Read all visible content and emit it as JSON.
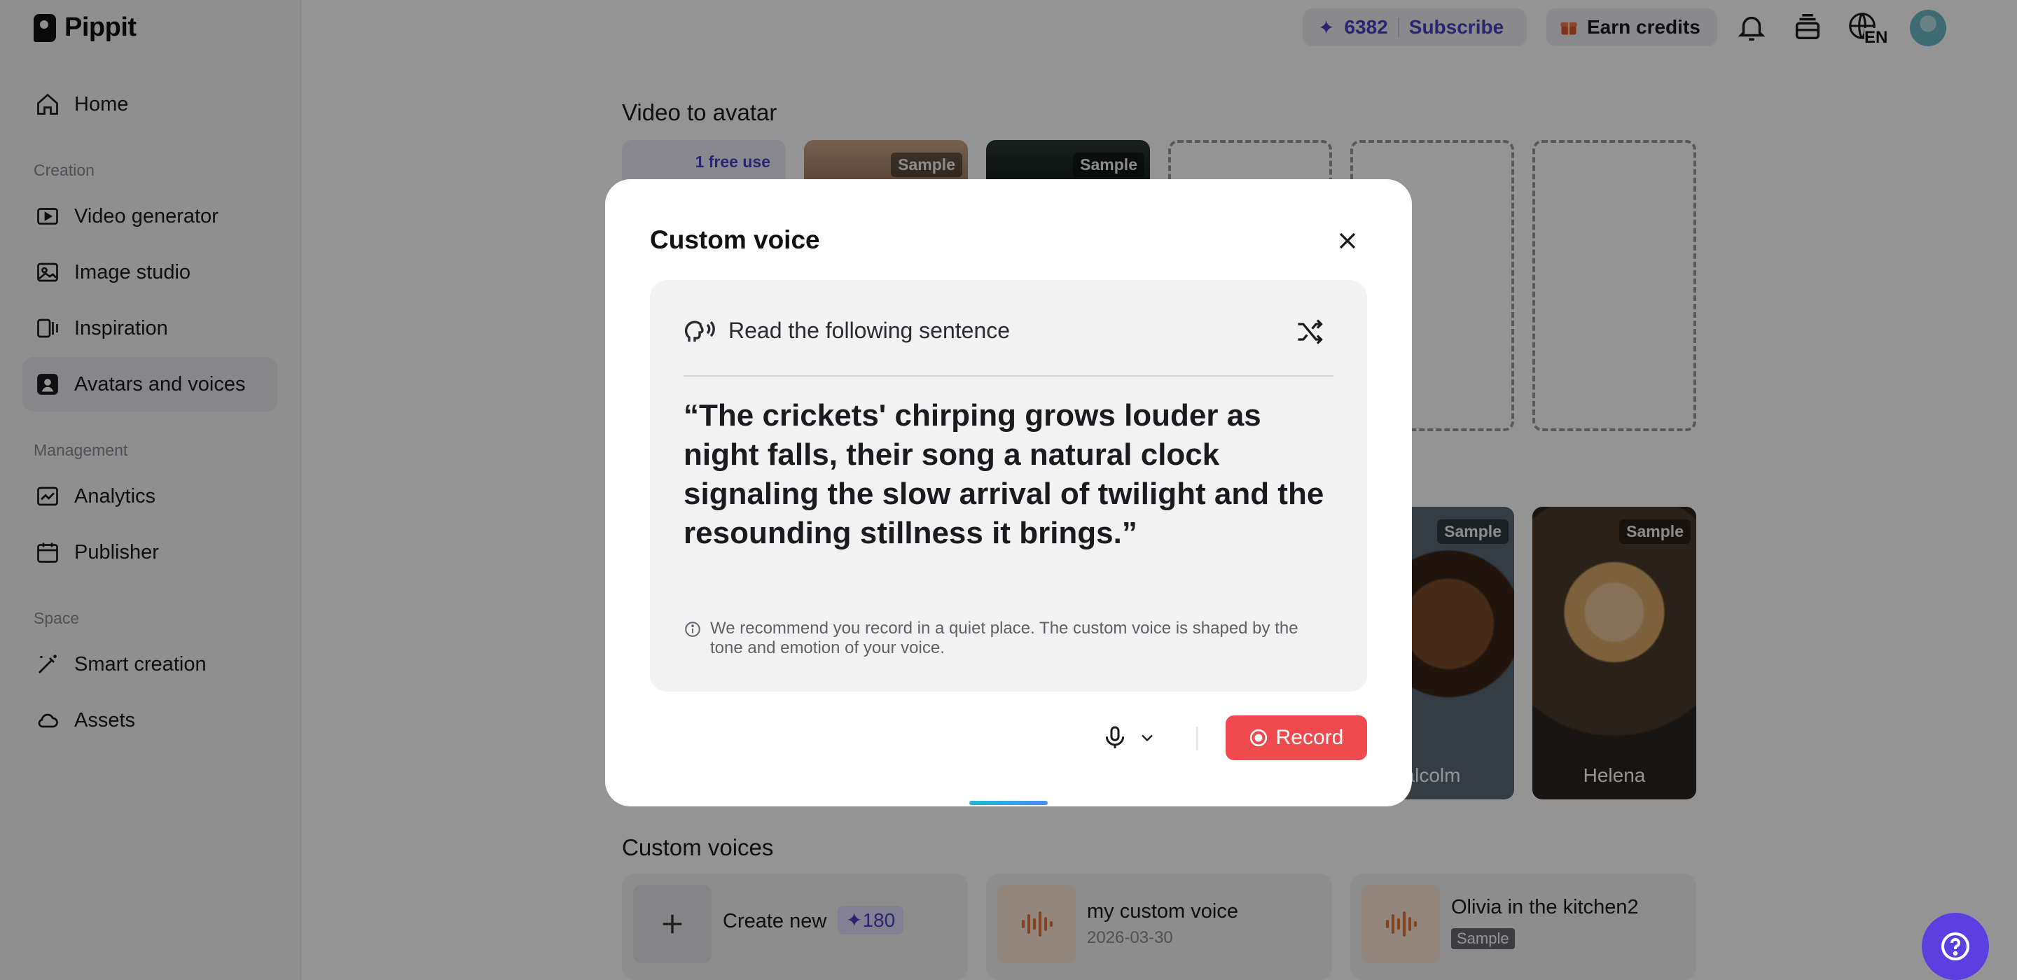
{
  "app": {
    "name": "Pippit"
  },
  "sidebar": {
    "items": [
      {
        "label": "Home",
        "icon": "home-icon"
      },
      {
        "label": "Video generator",
        "icon": "video-generator-icon"
      },
      {
        "label": "Image studio",
        "icon": "image-studio-icon"
      },
      {
        "label": "Inspiration",
        "icon": "inspiration-icon"
      },
      {
        "label": "Avatars and voices",
        "icon": "avatar-icon",
        "active": true
      },
      {
        "label": "Analytics",
        "icon": "analytics-icon"
      },
      {
        "label": "Publisher",
        "icon": "calendar-icon"
      },
      {
        "label": "Smart creation",
        "icon": "magic-wand-icon"
      },
      {
        "label": "Assets",
        "icon": "cloud-icon"
      }
    ],
    "sections": {
      "creation": "Creation",
      "management": "Management",
      "space": "Space"
    }
  },
  "topbar": {
    "credits": "6382",
    "subscribe": "Subscribe",
    "earn_credits": "Earn credits",
    "language": "EN"
  },
  "main": {
    "video_to_avatar_title": "Video to avatar",
    "free_use_badge": "1 free use",
    "sample_label": "Sample",
    "avatars": [
      {
        "name": "alcolm"
      },
      {
        "name": "Helena"
      }
    ],
    "custom_voices_title": "Custom voices",
    "create_new": {
      "label": "Create new",
      "cost": "180"
    },
    "voices": [
      {
        "title": "my custom voice",
        "date": "2026-03-30"
      },
      {
        "title": "Olivia in the kitchen2",
        "badge": "Sample"
      }
    ]
  },
  "modal": {
    "title": "Custom voice",
    "read_header": "Read the following sentence",
    "sentence": "“The crickets' chirping grows louder as night falls, their song a natural clock signaling the slow arrival of twilight and the resounding stillness it brings.”",
    "tip": "We recommend you record in a quiet place. The custom voice is shaped by the tone and emotion of your voice.",
    "record_label": "Record"
  },
  "colors": {
    "accent": "#5b3fe0",
    "record": "#f04a4f",
    "credits_text": "#4a3fc4"
  }
}
